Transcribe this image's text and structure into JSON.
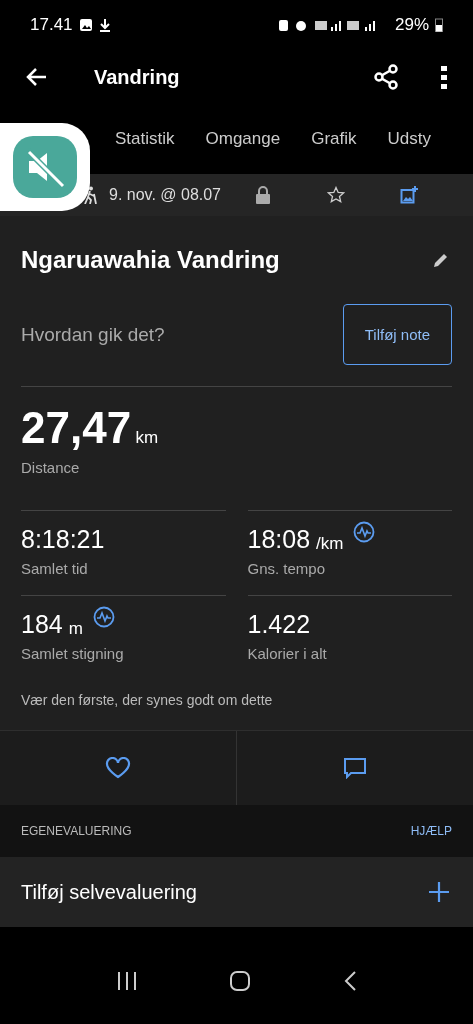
{
  "status_bar": {
    "time": "17.41",
    "battery": "29%"
  },
  "app_bar": {
    "title": "Vandring"
  },
  "tabs": [
    {
      "label": "Statistik"
    },
    {
      "label": "Omgange"
    },
    {
      "label": "Grafik"
    },
    {
      "label": "Udsty"
    }
  ],
  "activity": {
    "date": "9. nov. @ 08.07",
    "title": "Ngaruawahia Vandring",
    "prompt": "Hvordan gik det?",
    "note_button": "Tilføj note"
  },
  "distance": {
    "value": "27,47",
    "unit": "km",
    "label": "Distance"
  },
  "stats": [
    {
      "value": "8:18:21",
      "label": "Samlet tid",
      "chart_icon": false
    },
    {
      "value": "18:08",
      "unit": "/km",
      "label": "Gns. tempo",
      "chart_icon": true
    },
    {
      "value": "184",
      "unit": "m",
      "label": "Samlet stigning",
      "chart_icon": true
    },
    {
      "value": "1.422",
      "label": "Kalorier i alt",
      "chart_icon": false
    }
  ],
  "likes_text": "Vær den første, der synes godt om dette",
  "self_evaluation": {
    "header": "EGENEVALUERING",
    "help": "HJÆLP",
    "add": "Tilføj selvevaluering"
  }
}
